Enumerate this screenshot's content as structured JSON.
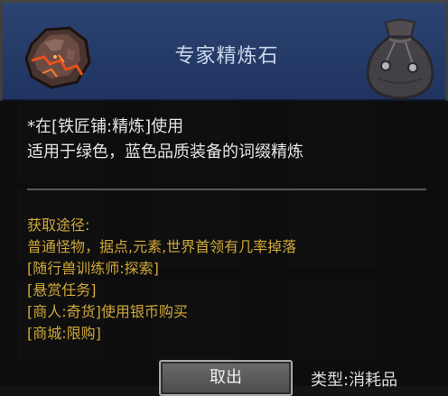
{
  "item": {
    "name": "专家精炼石",
    "usage": "*在[铁匠铺:精炼]使用",
    "description": "适用于绿色，蓝色品质装备的词缀精炼"
  },
  "sources": {
    "heading": "获取途径:",
    "lines": [
      "普通怪物，据点,元素,世界首领有几率掉落",
      "[随行兽训练师:探索]",
      "[悬赏任务]",
      "[商人:奇货]使用银币购买",
      "[商城:限购]"
    ]
  },
  "actions": {
    "take_out_label": "取出"
  },
  "type_label": "类型:消耗品",
  "icons": {
    "item": "refining-stone-icon",
    "bag": "bag-icon"
  }
}
